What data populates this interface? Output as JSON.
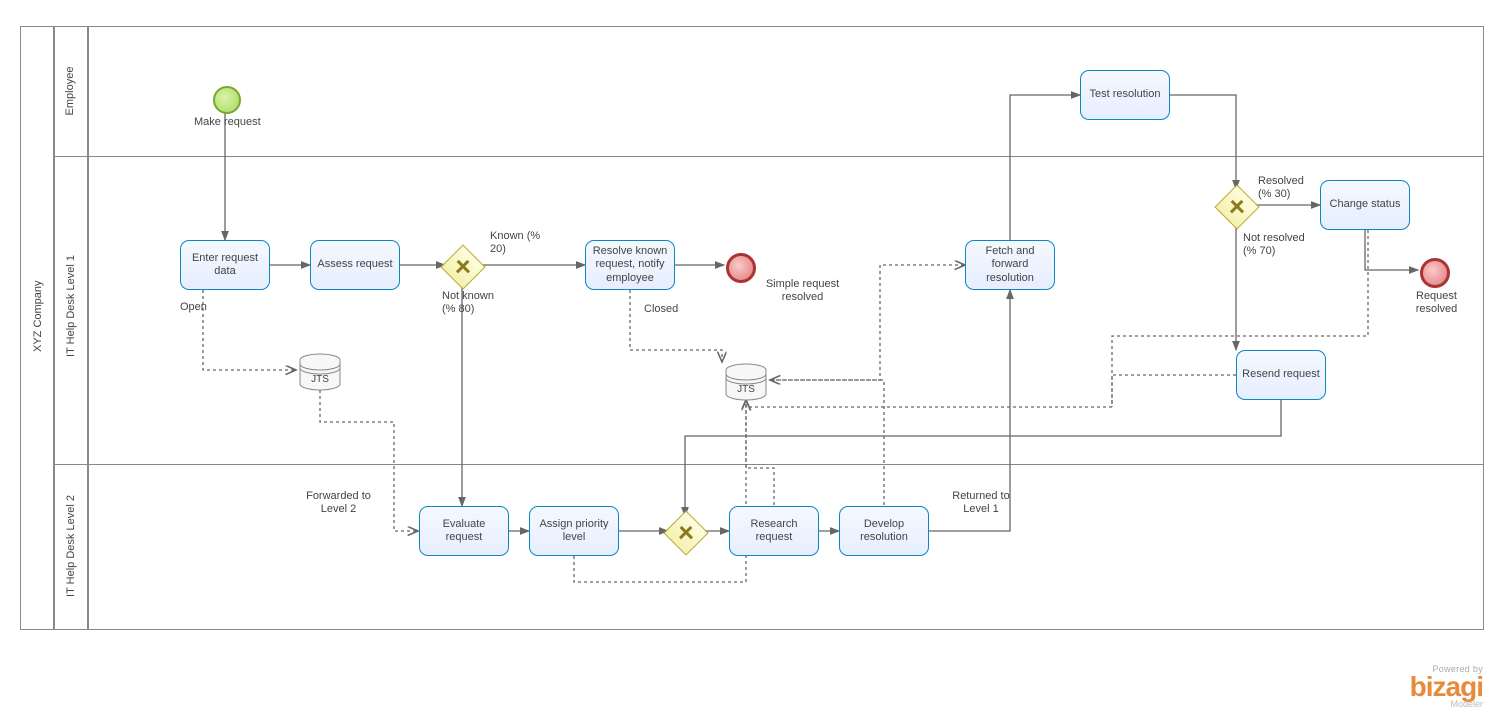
{
  "pool": {
    "title": "XYZ Company"
  },
  "lanes": {
    "employee": "Employee",
    "level1": "IT Help Desk Level 1",
    "level2": "IT Help Desk Level 2"
  },
  "events": {
    "start_label": "Make request",
    "end_simple": "Simple request resolved",
    "end_resolved": "Request resolved"
  },
  "tasks": {
    "enter": "Enter request data",
    "assess": "Assess request",
    "resolve_known": "Resolve known request, notify employee",
    "fetch_forward": "Fetch and forward resolution",
    "test_resolution": "Test resolution",
    "change_status": "Change status",
    "resend": "Resend request",
    "evaluate": "Evaluate request",
    "assign_priority": "Assign priority level",
    "research": "Research request",
    "develop_resolution": "Develop resolution"
  },
  "gateways": {
    "known": "Known (% 20)",
    "not_known": "Not known (% 80)",
    "resolved": "Resolved (% 30)",
    "not_resolved": "Not resolved (% 70)"
  },
  "datastores": {
    "jts": "JTS"
  },
  "flow_labels": {
    "open": "Open",
    "closed": "Closed",
    "forwarded": "Forwarded to Level 2",
    "returned": "Returned to Level 1"
  },
  "branding": {
    "powered_by": "Powered by",
    "name": "bizagi",
    "sub": "Modeler"
  }
}
